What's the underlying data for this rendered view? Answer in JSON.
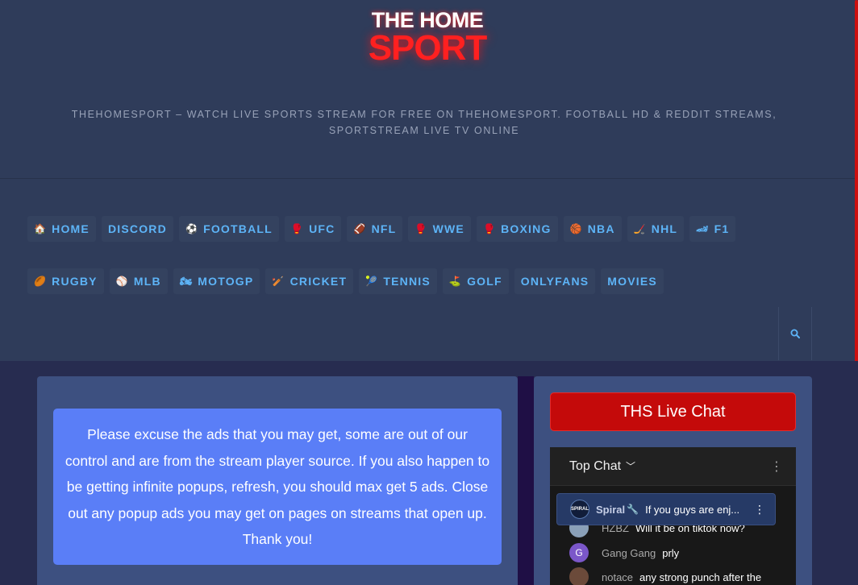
{
  "header": {
    "logo_line1": "THE HOME",
    "logo_line2": "SPORT",
    "tagline": "THEHOMESPORT – WATCH LIVE SPORTS STREAM FOR FREE ON THEHOMESPORT. FOOTBALL HD & REDDIT STREAMS, SPORTSTREAM LIVE TV ONLINE"
  },
  "nav": {
    "row1": [
      {
        "icon": "house-icon",
        "glyph": "🏠",
        "label": "HOME"
      },
      {
        "icon": "",
        "glyph": "",
        "label": "DISCORD"
      },
      {
        "icon": "soccer-ball-icon",
        "glyph": "⚽",
        "label": "FOOTBALL"
      },
      {
        "icon": "boxing-glove-icon",
        "glyph": "🥊",
        "label": "UFC"
      },
      {
        "icon": "american-football-icon",
        "glyph": "🏈",
        "label": "NFL"
      },
      {
        "icon": "boxing-glove-icon",
        "glyph": "🥊",
        "label": "WWE"
      },
      {
        "icon": "boxing-glove-icon",
        "glyph": "🥊",
        "label": "BOXING"
      },
      {
        "icon": "basketball-icon",
        "glyph": "🏀",
        "label": "NBA"
      },
      {
        "icon": "hockey-stick-icon",
        "glyph": "🏒",
        "label": "NHL"
      },
      {
        "icon": "race-car-icon",
        "glyph": "🏎",
        "label": "F1"
      }
    ],
    "row2": [
      {
        "icon": "rugby-ball-icon",
        "glyph": "🏉",
        "label": "RUGBY"
      },
      {
        "icon": "baseball-icon",
        "glyph": "⚾",
        "label": "MLB"
      },
      {
        "icon": "motorcycle-icon",
        "glyph": "🏍",
        "label": "MOTOGP"
      },
      {
        "icon": "cricket-icon",
        "glyph": "🏏",
        "label": "CRICKET"
      },
      {
        "icon": "tennis-racket-icon",
        "glyph": "🎾",
        "label": "TENNIS"
      },
      {
        "icon": "golf-flag-icon",
        "glyph": "⛳",
        "label": "GOLF"
      },
      {
        "icon": "",
        "glyph": "",
        "label": "ONLYFANS"
      },
      {
        "icon": "",
        "glyph": "",
        "label": "MOVIES"
      }
    ],
    "search_icon": "search-icon"
  },
  "notice": {
    "text": "Please excuse the ads that you may get, some are out of our control and are from the stream player source. If you also happen to be getting infinite popups, refresh, you should max get 5 ads. Close out any popup ads you may get on pages on streams that open up. Thank you!"
  },
  "chat": {
    "button_label": "THS Live Chat",
    "header_title": "Top Chat",
    "pinned": {
      "avatar_text": "SPIRAL",
      "name": "Spiral",
      "name_icon": "wrench-icon",
      "message": "If you guys are enj..."
    },
    "messages": [
      {
        "name": "HZBZ",
        "text": "Will it be on tiktok now?",
        "avatar_color": "#8aa0b8",
        "avatar_text": ""
      },
      {
        "name": "Gang Gang",
        "text": "prly",
        "avatar_color": "#7b57c9",
        "avatar_text": "G"
      },
      {
        "name": "notace",
        "text": "any strong punch after the",
        "avatar_color": "#6b4a3a",
        "avatar_text": ""
      }
    ]
  },
  "colors": {
    "accent_blue": "#5db4f7",
    "brand_red": "#ff2020",
    "chat_button": "#c40a0a",
    "notice_bg": "#5a7ef7"
  }
}
